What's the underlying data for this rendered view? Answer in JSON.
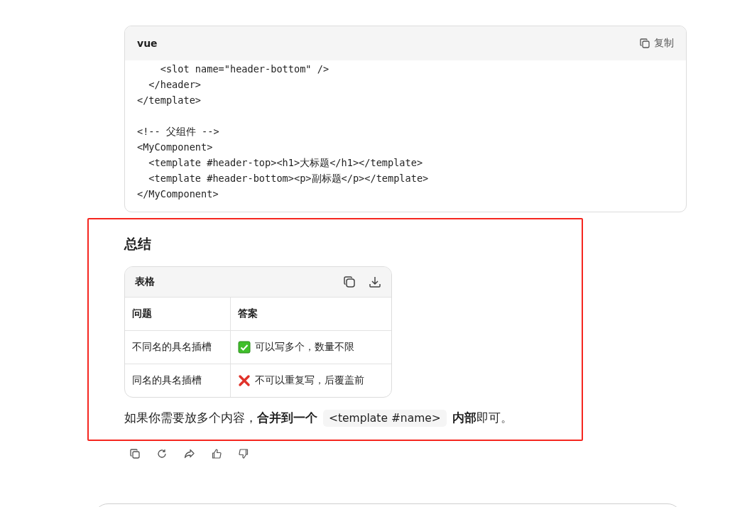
{
  "code_block": {
    "language": "vue",
    "copy_label": "复制",
    "lines": [
      [
        "    <slot name=\"header-bottom\" />",
        "  </header>",
        "</template>"
      ],
      [
        "<!-- 父组件 -->",
        "<MyComponent>",
        "  <template #header-top><h1>大标题</h1></template>",
        "  <template #header-bottom><p>副标题</p></template>",
        "</MyComponent>"
      ]
    ]
  },
  "summary": {
    "heading": "总结",
    "table": {
      "title": "表格",
      "columns": [
        "问题",
        "答案"
      ],
      "rows": [
        {
          "question": "不同名的具名插槽",
          "kind": "positive",
          "answer": "可以写多个，数量不限"
        },
        {
          "question": "同名的具名插槽",
          "kind": "negative",
          "answer": "不可以重复写，后覆盖前"
        }
      ]
    },
    "paragraph": [
      {
        "kind": "text",
        "text": "如果你需要放多个内容，**合并到一个**"
      },
      {
        "kind": "code",
        "text": "<template #name>"
      },
      {
        "kind": "text",
        "text": "**内部**即可。"
      }
    ]
  },
  "highlight": {
    "color": "#f5261f"
  }
}
